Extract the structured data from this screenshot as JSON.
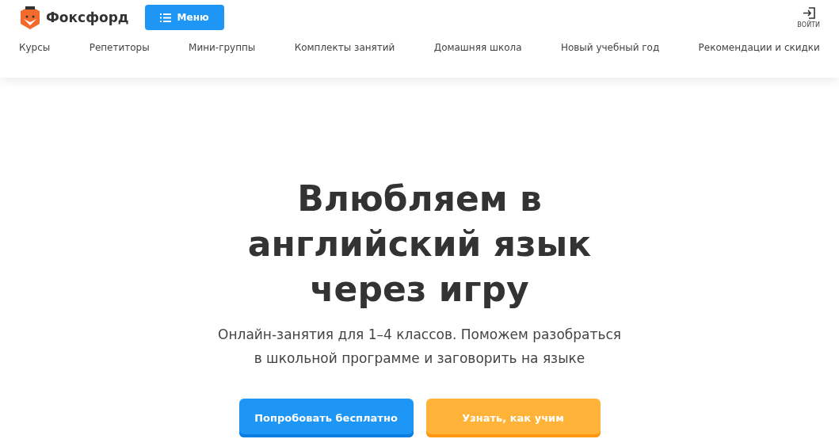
{
  "header": {
    "logo": "Фоксфорд",
    "menu_button": "Меню",
    "login": "ВОЙТИ"
  },
  "nav": [
    "Курсы",
    "Репетиторы",
    "Мини-группы",
    "Комплекты занятий",
    "Домашняя школа",
    "Новый учебный год",
    "Рекомендации и скидки"
  ],
  "hero": {
    "title": "Влюбляем в английский язык через игру",
    "subtitle": "Онлайн-занятия для 1–4 классов. Поможем разобраться в школьной программе и заговорить на языке",
    "buttons": [
      {
        "label": "Попробовать бесплатно",
        "kind": "primary"
      },
      {
        "label": "Узнать, как учим",
        "kind": "secondary"
      }
    ]
  }
}
